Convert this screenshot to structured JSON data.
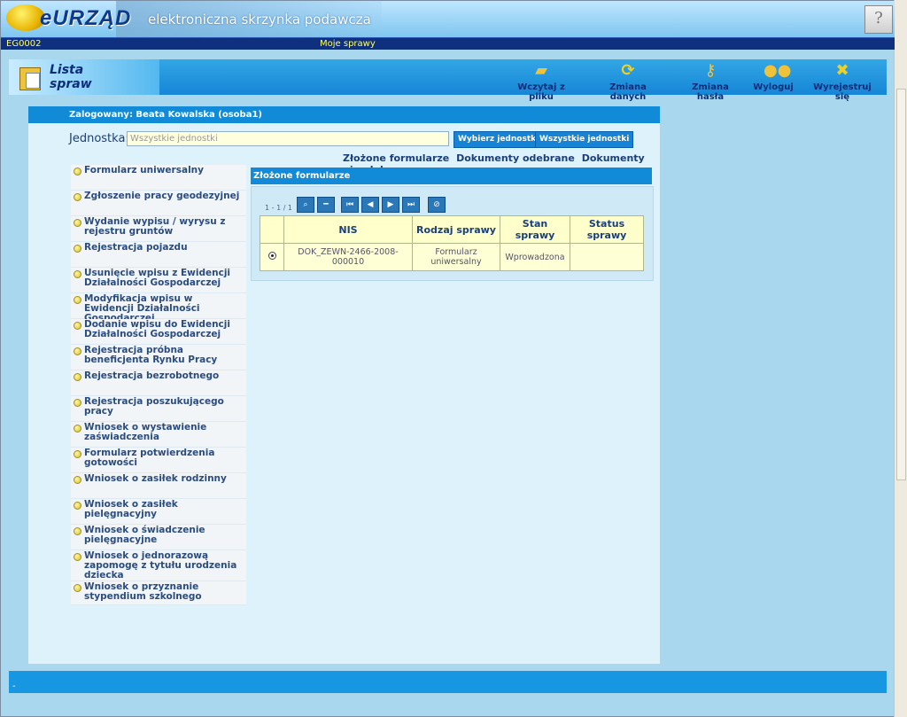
{
  "header": {
    "logo": "eURZĄD",
    "tagline": "elektroniczna skrzynka podawcza",
    "help": "?"
  },
  "statusbar": {
    "code": "EG0002",
    "title": "Moje sprawy"
  },
  "toolbar": {
    "title_line1": "Lista",
    "title_line2": "spraw",
    "items": [
      {
        "label": "Wczytaj z pliku"
      },
      {
        "label": "Zmiana danych"
      },
      {
        "label": "Zmiana hasła"
      },
      {
        "label": "Wyloguj"
      },
      {
        "label": "Wyrejestruj się"
      }
    ]
  },
  "panel": {
    "logged_in": "Zalogowany: Beata Kowalska (osoba1)",
    "unit_label": "Jednostka:",
    "unit_value": "Wszystkie jednostki",
    "select_unit_btn": "Wybierz jednostkę",
    "all_units_btn": "Wszystkie jednostki",
    "tabs": [
      "Złożone formularze",
      "Dokumenty odebrane",
      "Dokumenty nieodebrane"
    ]
  },
  "sidebar": {
    "items": [
      {
        "label": "Formularz uniwersalny"
      },
      {
        "label": "Zgłoszenie pracy geodezyjnej"
      },
      {
        "label": "Wydanie wypisu / wyrysu z rejestru gruntów"
      },
      {
        "label": "Rejestracja pojazdu"
      },
      {
        "label": "Usunięcie wpisu z Ewidencji Działalności Gospodarczej"
      },
      {
        "label": "Modyfikacja wpisu w Ewidencji Działalności Gospodarczej"
      },
      {
        "label": "Dodanie wpisu do Ewidencji Działalności Gospodarczej"
      },
      {
        "label": "Rejestracja próbna beneficjenta Rynku Pracy"
      },
      {
        "label": "Rejestracja bezrobotnego"
      },
      {
        "label": "Rejestracja poszukującego pracy"
      },
      {
        "label": "Wniosek o wystawienie zaświadczenia"
      },
      {
        "label": "Formularz potwierdzenia gotowości"
      },
      {
        "label": "Wniosek o zasiłek rodzinny"
      },
      {
        "label": "Wniosek o zasiłek pielęgnacyjny"
      },
      {
        "label": "Wniosek o świadczenie pielęgnacyjne"
      },
      {
        "label": "Wniosek o jednorazową zapomogę z tytułu urodzenia dziecka"
      },
      {
        "label": "Wniosek o przyznanie stypendium szkolnego"
      }
    ]
  },
  "forms": {
    "header": "Złożone formularze",
    "pager": "1 - 1 / 1",
    "columns": [
      "NIS",
      "Rodzaj sprawy",
      "Stan sprawy",
      "Status sprawy"
    ],
    "rows": [
      {
        "nis": "DOK_ZEWN-2466-2008-000010",
        "rodzaj": "Formularz uniwersalny",
        "stan": "Wprowadzona",
        "status": ""
      }
    ]
  },
  "footer": {
    "text": "-"
  }
}
